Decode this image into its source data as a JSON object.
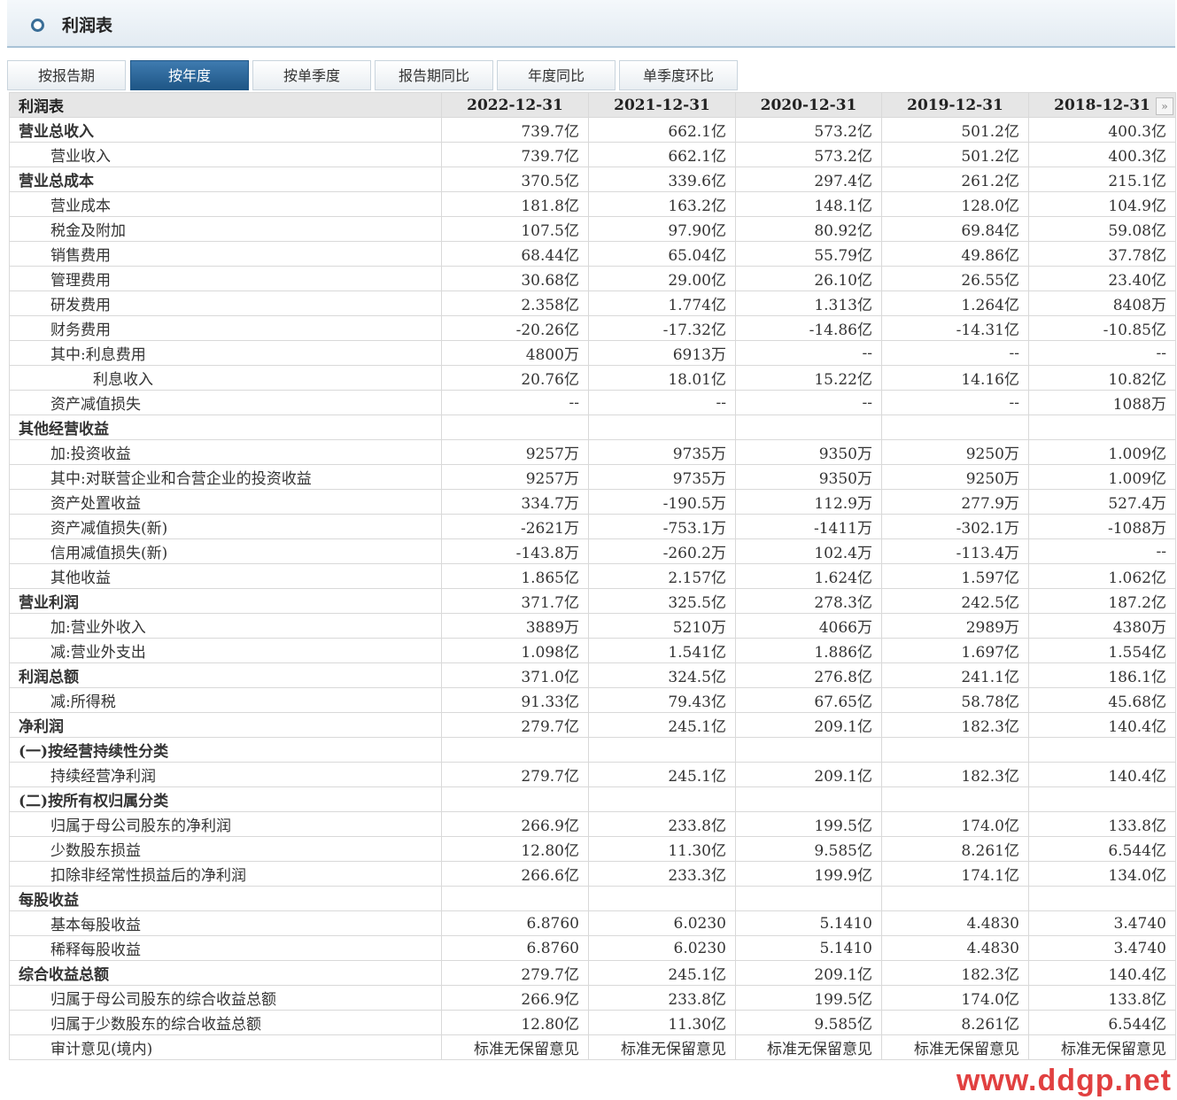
{
  "header": {
    "title": "利润表"
  },
  "tabs": [
    {
      "label": "按报告期",
      "active": false
    },
    {
      "label": "按年度",
      "active": true
    },
    {
      "label": "按单季度",
      "active": false
    },
    {
      "label": "报告期同比",
      "active": false
    },
    {
      "label": "年度同比",
      "active": false
    },
    {
      "label": "单季度环比",
      "active": false
    }
  ],
  "table": {
    "columns": [
      "利润表",
      "2022-12-31",
      "2021-12-31",
      "2020-12-31",
      "2019-12-31",
      "2018-12-31"
    ],
    "rows": [
      {
        "label": "营业总收入",
        "level": 0,
        "values": [
          "739.7亿",
          "662.1亿",
          "573.2亿",
          "501.2亿",
          "400.3亿"
        ]
      },
      {
        "label": "营业收入",
        "level": 1,
        "values": [
          "739.7亿",
          "662.1亿",
          "573.2亿",
          "501.2亿",
          "400.3亿"
        ]
      },
      {
        "label": "营业总成本",
        "level": 0,
        "values": [
          "370.5亿",
          "339.6亿",
          "297.4亿",
          "261.2亿",
          "215.1亿"
        ]
      },
      {
        "label": "营业成本",
        "level": 1,
        "values": [
          "181.8亿",
          "163.2亿",
          "148.1亿",
          "128.0亿",
          "104.9亿"
        ]
      },
      {
        "label": "税金及附加",
        "level": 1,
        "values": [
          "107.5亿",
          "97.90亿",
          "80.92亿",
          "69.84亿",
          "59.08亿"
        ]
      },
      {
        "label": "销售费用",
        "level": 1,
        "values": [
          "68.44亿",
          "65.04亿",
          "55.79亿",
          "49.86亿",
          "37.78亿"
        ]
      },
      {
        "label": "管理费用",
        "level": 1,
        "values": [
          "30.68亿",
          "29.00亿",
          "26.10亿",
          "26.55亿",
          "23.40亿"
        ]
      },
      {
        "label": "研发费用",
        "level": 1,
        "values": [
          "2.358亿",
          "1.774亿",
          "1.313亿",
          "1.264亿",
          "8408万"
        ]
      },
      {
        "label": "财务费用",
        "level": 1,
        "values": [
          "-20.26亿",
          "-17.32亿",
          "-14.86亿",
          "-14.31亿",
          "-10.85亿"
        ]
      },
      {
        "label": "其中:利息费用",
        "level": 1,
        "values": [
          "4800万",
          "6913万",
          "--",
          "--",
          "--"
        ]
      },
      {
        "label": "利息收入",
        "level": 2,
        "values": [
          "20.76亿",
          "18.01亿",
          "15.22亿",
          "14.16亿",
          "10.82亿"
        ]
      },
      {
        "label": "资产减值损失",
        "level": 1,
        "values": [
          "--",
          "--",
          "--",
          "--",
          "1088万"
        ]
      },
      {
        "label": "其他经营收益",
        "level": 0,
        "values": [
          "",
          "",
          "",
          "",
          ""
        ]
      },
      {
        "label": "加:投资收益",
        "level": 1,
        "values": [
          "9257万",
          "9735万",
          "9350万",
          "9250万",
          "1.009亿"
        ]
      },
      {
        "label": "其中:对联营企业和合营企业的投资收益",
        "level": 1,
        "values": [
          "9257万",
          "9735万",
          "9350万",
          "9250万",
          "1.009亿"
        ]
      },
      {
        "label": "资产处置收益",
        "level": 1,
        "values": [
          "334.7万",
          "-190.5万",
          "112.9万",
          "277.9万",
          "527.4万"
        ]
      },
      {
        "label": "资产减值损失(新)",
        "level": 1,
        "values": [
          "-2621万",
          "-753.1万",
          "-1411万",
          "-302.1万",
          "-1088万"
        ]
      },
      {
        "label": "信用减值损失(新)",
        "level": 1,
        "values": [
          "-143.8万",
          "-260.2万",
          "102.4万",
          "-113.4万",
          "--"
        ]
      },
      {
        "label": "其他收益",
        "level": 1,
        "values": [
          "1.865亿",
          "2.157亿",
          "1.624亿",
          "1.597亿",
          "1.062亿"
        ]
      },
      {
        "label": "营业利润",
        "level": 0,
        "values": [
          "371.7亿",
          "325.5亿",
          "278.3亿",
          "242.5亿",
          "187.2亿"
        ]
      },
      {
        "label": "加:营业外收入",
        "level": 1,
        "values": [
          "3889万",
          "5210万",
          "4066万",
          "2989万",
          "4380万"
        ]
      },
      {
        "label": "减:营业外支出",
        "level": 1,
        "values": [
          "1.098亿",
          "1.541亿",
          "1.886亿",
          "1.697亿",
          "1.554亿"
        ]
      },
      {
        "label": "利润总额",
        "level": 0,
        "values": [
          "371.0亿",
          "324.5亿",
          "276.8亿",
          "241.1亿",
          "186.1亿"
        ]
      },
      {
        "label": "减:所得税",
        "level": 1,
        "values": [
          "91.33亿",
          "79.43亿",
          "67.65亿",
          "58.78亿",
          "45.68亿"
        ]
      },
      {
        "label": "净利润",
        "level": 0,
        "values": [
          "279.7亿",
          "245.1亿",
          "209.1亿",
          "182.3亿",
          "140.4亿"
        ]
      },
      {
        "label": "(一)按经营持续性分类",
        "level": 0,
        "values": [
          "",
          "",
          "",
          "",
          ""
        ]
      },
      {
        "label": "持续经营净利润",
        "level": 1,
        "values": [
          "279.7亿",
          "245.1亿",
          "209.1亿",
          "182.3亿",
          "140.4亿"
        ]
      },
      {
        "label": "(二)按所有权归属分类",
        "level": 0,
        "values": [
          "",
          "",
          "",
          "",
          ""
        ]
      },
      {
        "label": "归属于母公司股东的净利润",
        "level": 1,
        "values": [
          "266.9亿",
          "233.8亿",
          "199.5亿",
          "174.0亿",
          "133.8亿"
        ]
      },
      {
        "label": "少数股东损益",
        "level": 1,
        "values": [
          "12.80亿",
          "11.30亿",
          "9.585亿",
          "8.261亿",
          "6.544亿"
        ]
      },
      {
        "label": "扣除非经常性损益后的净利润",
        "level": 1,
        "values": [
          "266.6亿",
          "233.3亿",
          "199.9亿",
          "174.1亿",
          "134.0亿"
        ]
      },
      {
        "label": "每股收益",
        "level": 0,
        "values": [
          "",
          "",
          "",
          "",
          ""
        ]
      },
      {
        "label": "基本每股收益",
        "level": 1,
        "values": [
          "6.8760",
          "6.0230",
          "5.1410",
          "4.4830",
          "3.4740"
        ]
      },
      {
        "label": "稀释每股收益",
        "level": 1,
        "values": [
          "6.8760",
          "6.0230",
          "5.1410",
          "4.4830",
          "3.4740"
        ]
      },
      {
        "label": "综合收益总额",
        "level": 0,
        "values": [
          "279.7亿",
          "245.1亿",
          "209.1亿",
          "182.3亿",
          "140.4亿"
        ]
      },
      {
        "label": "归属于母公司股东的综合收益总额",
        "level": 1,
        "values": [
          "266.9亿",
          "233.8亿",
          "199.5亿",
          "174.0亿",
          "133.8亿"
        ]
      },
      {
        "label": "归属于少数股东的综合收益总额",
        "level": 1,
        "values": [
          "12.80亿",
          "11.30亿",
          "9.585亿",
          "8.261亿",
          "6.544亿"
        ]
      },
      {
        "label": "审计意见(境内)",
        "level": 1,
        "values": [
          "标准无保留意见",
          "标准无保留意见",
          "标准无保留意见",
          "标准无保留意见",
          "标准无保留意见"
        ]
      }
    ]
  },
  "watermark": "www.ddgp.net",
  "icons": {
    "next": "double-chevron-right-icon",
    "header": "ring-icon"
  }
}
